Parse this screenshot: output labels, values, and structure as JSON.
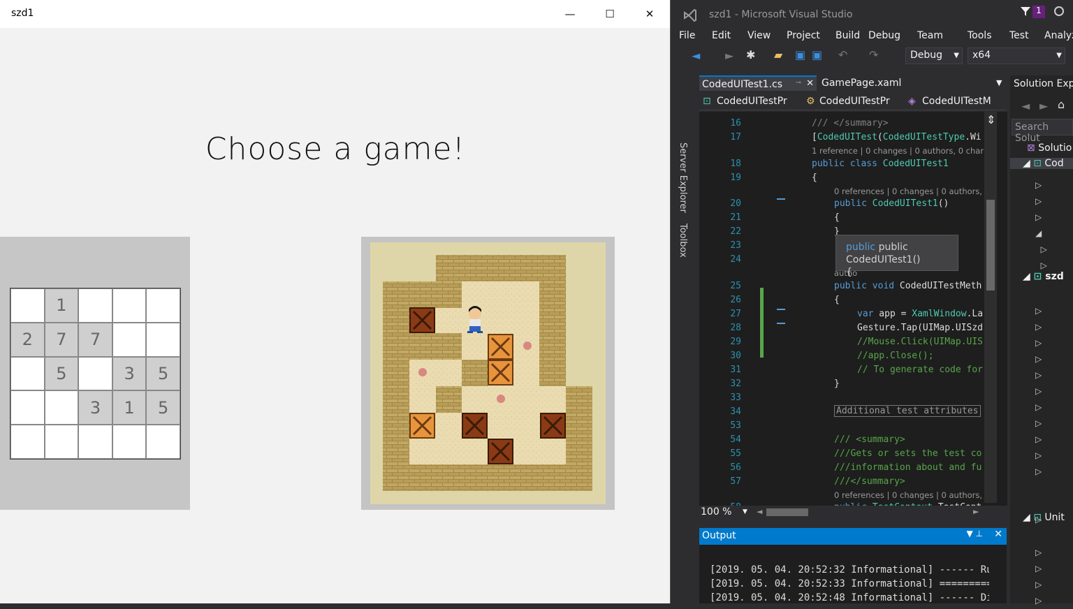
{
  "app": {
    "title": "szd1",
    "heading": "Choose a game!",
    "controls": {
      "minimize": "—",
      "maximize": "☐",
      "close": "✕"
    },
    "grid": [
      [
        "",
        "1",
        "",
        "",
        ""
      ],
      [
        "2",
        "7",
        "7",
        "",
        ""
      ],
      [
        "",
        "5",
        "",
        "3",
        "5"
      ],
      [
        "",
        "",
        "3",
        "1",
        "5"
      ],
      [
        "",
        "",
        "",
        "",
        ""
      ]
    ],
    "grid_shaded": [
      [
        0,
        1,
        0,
        0,
        0
      ],
      [
        1,
        1,
        1,
        0,
        0
      ],
      [
        0,
        1,
        0,
        1,
        1
      ],
      [
        0,
        0,
        1,
        1,
        1
      ],
      [
        0,
        0,
        0,
        0,
        0
      ]
    ]
  },
  "vs": {
    "title": "szd1 - Microsoft Visual Studio",
    "notif_count": "1",
    "menu": [
      "File",
      "Edit",
      "View",
      "Project",
      "Build",
      "Debug",
      "Team",
      "Tools",
      "Test",
      "Analyz"
    ],
    "config": "Debug",
    "platform": "x64",
    "side_tabs": [
      "Server Explorer",
      "Toolbox"
    ],
    "tabs": [
      "CodedUITest1.cs",
      "GamePage.xaml"
    ],
    "nav": [
      "CodedUITestPr",
      "CodedUITestPr",
      "CodedUITestM"
    ],
    "lines": [
      {
        "n": "16",
        "t": "/// </summary>",
        "c": "gr",
        "x": 0
      },
      {
        "n": "17",
        "t": "[CodedUITest(CodedUITestType.Wi",
        "c": "",
        "x": 0
      },
      {
        "n": "",
        "t": "1 reference | 0 changes | 0 authors, 0 chang",
        "c": "lens",
        "x": 0
      },
      {
        "n": "18",
        "t": "public class CodedUITest1",
        "c": "",
        "x": 0
      },
      {
        "n": "19",
        "t": "{",
        "c": "",
        "x": 0
      },
      {
        "n": "",
        "t": "0 references | 0 changes | 0 authors, 0",
        "c": "lens",
        "x": 1
      },
      {
        "n": "20",
        "t": "public CodedUITest1()",
        "c": "",
        "x": 1
      },
      {
        "n": "21",
        "t": "{",
        "c": "",
        "x": 1
      },
      {
        "n": "22",
        "t": "}",
        "c": "",
        "x": 1
      },
      {
        "n": "23",
        "t": "",
        "c": "",
        "x": 1
      },
      {
        "n": "24",
        "t": "",
        "c": "",
        "x": 1
      },
      {
        "n": "",
        "t": "autho",
        "c": "lens",
        "x": 1
      },
      {
        "n": "25",
        "t": "public void CodedUITestMeth",
        "c": "",
        "x": 1
      },
      {
        "n": "26",
        "t": "{",
        "c": "",
        "x": 1
      },
      {
        "n": "27",
        "t": "var app = XamlWindow.La",
        "c": "",
        "x": 2
      },
      {
        "n": "28",
        "t": "Gesture.Tap(UIMap.UISzd",
        "c": "",
        "x": 2
      },
      {
        "n": "29",
        "t": "//Mouse.Click(UIMap.UIS",
        "c": "cm",
        "x": 2
      },
      {
        "n": "30",
        "t": "//app.Close();",
        "c": "cm",
        "x": 2
      },
      {
        "n": "31",
        "t": "// To generate code for",
        "c": "cm",
        "x": 2
      },
      {
        "n": "32",
        "t": "}",
        "c": "",
        "x": 1
      },
      {
        "n": "33",
        "t": "",
        "c": "",
        "x": 1
      },
      {
        "n": "34",
        "t": "Additional test attributes",
        "c": "box",
        "x": 1
      },
      {
        "n": "53",
        "t": "",
        "c": "",
        "x": 1
      },
      {
        "n": "54",
        "t": "/// <summary>",
        "c": "cm",
        "x": 1
      },
      {
        "n": "55",
        "t": "///Gets or sets the test co",
        "c": "cm",
        "x": 1
      },
      {
        "n": "56",
        "t": "///information about and fu",
        "c": "cm",
        "x": 1
      },
      {
        "n": "57",
        "t": "///</summary>",
        "c": "cm",
        "x": 1
      },
      {
        "n": "",
        "t": "0 references | 0 changes | 0 authors, 0",
        "c": "lens",
        "x": 1
      },
      {
        "n": "58",
        "t": "public TestContext TestCont",
        "c": "",
        "x": 1
      }
    ],
    "tooltip": [
      "public CodedUITest1()",
      "{"
    ],
    "zoom": "100 %",
    "output_title": "Output",
    "output_lines": [
      "[2019. 05. 04. 20:52:32 Informational] ------ Run",
      "[2019. 05. 04. 20:52:33 Informational] ==========",
      "[2019. 05. 04. 20:52:48 Informational] ------ Disc"
    ],
    "se": {
      "title": "Solution Expl",
      "search": "Search Solut",
      "items": [
        "Solutio",
        "Cod",
        "szd",
        "Unit"
      ]
    }
  }
}
